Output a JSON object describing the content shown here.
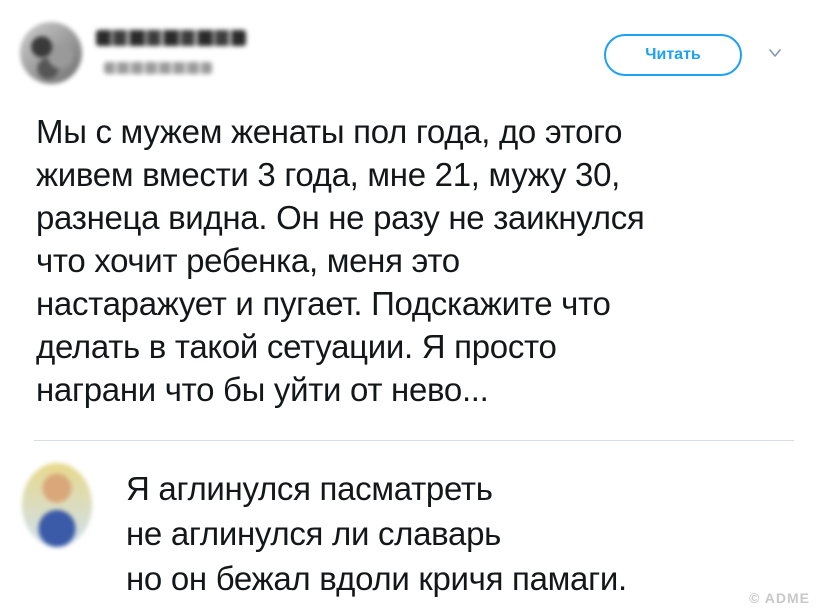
{
  "header": {
    "follow_label": "Читать",
    "chevron_icon": "chevron-down-icon",
    "accent_color": "#1da1f2"
  },
  "tweet": {
    "lines": [
      "Мы с мужем женаты пол года, до этого",
      "живем вмести 3 года, мне 21, мужу 30,",
      "разнеца видна. Он не разу не заикнулся",
      "что хочит ребенка, меня это",
      "настаражует и пугает. Подскажите что",
      "делать в такой сетуации. Я просто",
      "награни что бы уйти от нево..."
    ]
  },
  "reply": {
    "lines": [
      "Я аглинулся пасматреть",
      "не аглинулся ли славарь",
      "но он бежал вдоли кричя памаги."
    ]
  },
  "watermark": "© ADME"
}
